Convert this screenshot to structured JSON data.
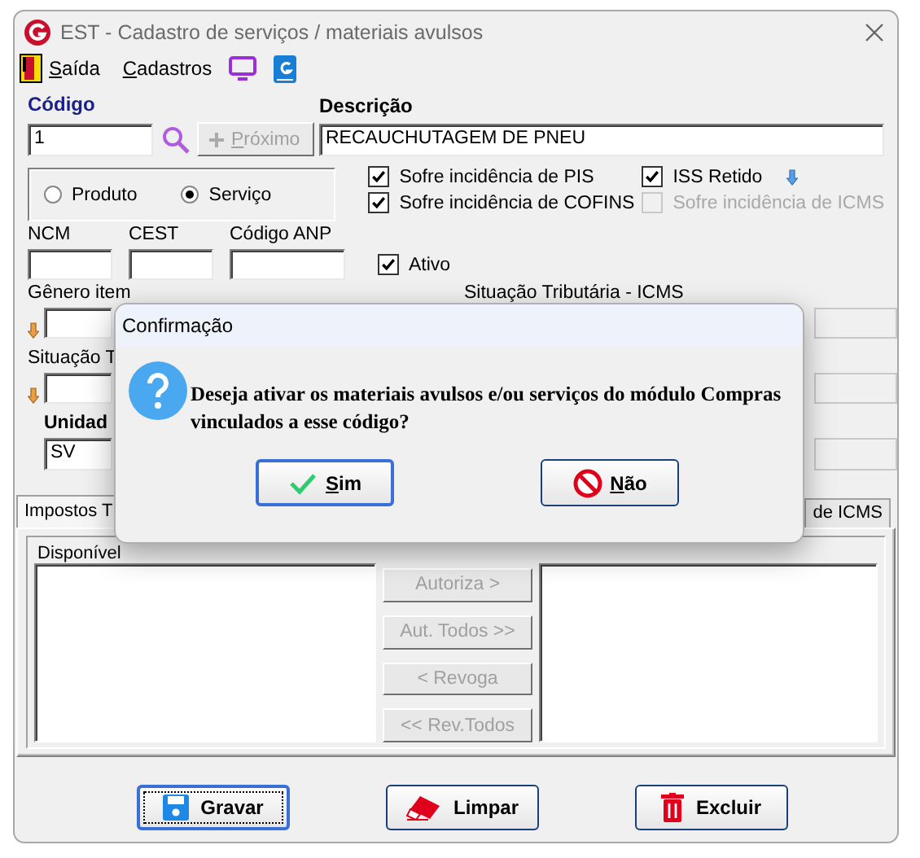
{
  "window": {
    "title": "EST - Cadastro de serviços / materiais avulsos"
  },
  "menu": [
    {
      "kind": "exit",
      "label": "Saída"
    },
    {
      "kind": "text",
      "label": "Cadastros"
    },
    {
      "kind": "monitor"
    },
    {
      "kind": "help"
    }
  ],
  "codigo": {
    "label": "Código",
    "value": "1"
  },
  "next_button": {
    "label": "Próximo",
    "disabled": true
  },
  "descricao": {
    "label": "Descrição",
    "value": "RECAUCHUTAGEM DE PNEU"
  },
  "type_options": [
    {
      "label": "Produto",
      "selected": false
    },
    {
      "label": "Serviço",
      "selected": true
    }
  ],
  "checkboxes": [
    {
      "label": "Sofre incidência de PIS",
      "checked": true,
      "disabled": false,
      "arrow": false
    },
    {
      "label": "Sofre incidência de COFINS",
      "checked": true,
      "disabled": false,
      "arrow": false
    },
    {
      "label": "ISS Retido",
      "checked": true,
      "disabled": false,
      "arrow": true
    },
    {
      "label": "Sofre incidência de ICMS",
      "checked": false,
      "disabled": true,
      "arrow": false
    }
  ],
  "small_fields": [
    {
      "label": "NCM"
    },
    {
      "label": "CEST"
    },
    {
      "label": "Código ANP"
    }
  ],
  "ativo": {
    "label": "Ativo",
    "checked": true
  },
  "genero": {
    "label": "Gênero item"
  },
  "situacao_icms": {
    "label": "Situação Tributária - ICMS"
  },
  "situacao": {
    "label": "Situação T"
  },
  "unidade": {
    "label": "Unidad",
    "value": "SV"
  },
  "tabs": [
    {
      "label": "Impostos T",
      "selected": true
    },
    {
      "label": "de ICMS",
      "selected": false
    }
  ],
  "available_list": {
    "label": "Disponível"
  },
  "transfer_buttons": [
    {
      "label": "Autoriza >",
      "disabled": true
    },
    {
      "label": "Aut. Todos >>",
      "disabled": true
    },
    {
      "label": "< Revoga",
      "disabled": true
    },
    {
      "label": "<< Rev.Todos",
      "disabled": true
    }
  ],
  "actions": [
    {
      "kind": "save",
      "label": "Gravar",
      "focused": true
    },
    {
      "kind": "clear",
      "label": "Limpar",
      "focused": false
    },
    {
      "kind": "delete",
      "label": "Excluir",
      "focused": false
    }
  ],
  "dialog": {
    "title": "Confirmação",
    "message": "Deseja ativar os materiais avulsos e/ou serviços do módulo Compras vinculados a esse código?",
    "buttons": [
      {
        "kind": "yes",
        "label": "Sim",
        "default": true
      },
      {
        "kind": "no",
        "label": "Não",
        "default": false
      }
    ]
  }
}
